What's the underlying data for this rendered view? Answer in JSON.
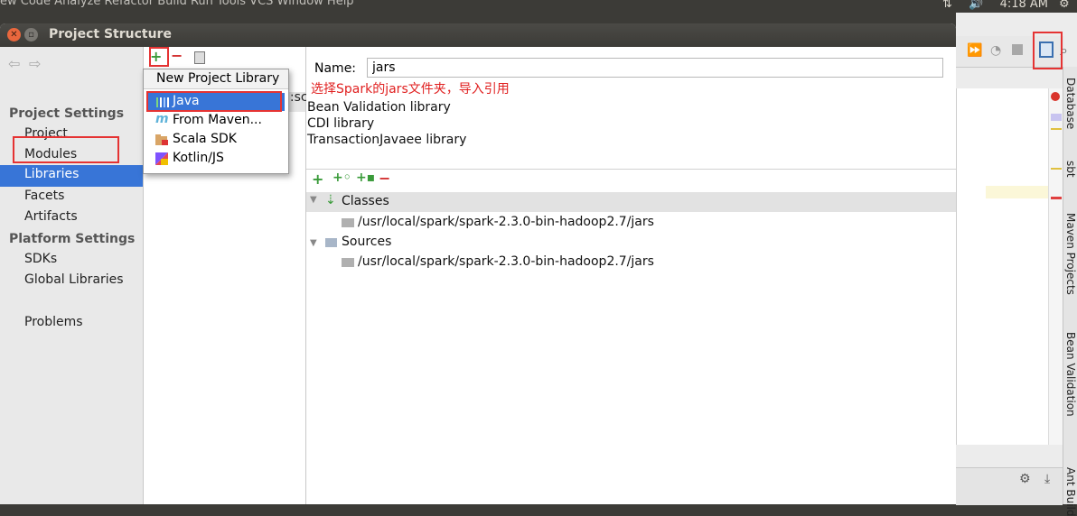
{
  "system_bar": {
    "menu_ghost": "ew   Code   Analyze   Refactor   Build   Run   Tools   VCS   Window   Help",
    "clock": "4:18 AM"
  },
  "ide": {
    "side_tabs": [
      "Database",
      "sbt",
      "Maven Projects",
      "Bean Validation",
      "Ant Build"
    ]
  },
  "dialog": {
    "title": "Project Structure",
    "sidebar": {
      "project_settings_header": "Project Settings",
      "project_items": [
        "Project",
        "Modules",
        "Libraries",
        "Facets",
        "Artifacts"
      ],
      "platform_settings_header": "Platform Settings",
      "platform_items": [
        "SDKs",
        "Global Libraries"
      ],
      "other_items": [
        "Problems"
      ],
      "selected": "Libraries"
    },
    "middle": {
      "partial_text": "g:sc"
    },
    "detail": {
      "name_label": "Name:",
      "name_value": "jars",
      "annotation": "选择Spark的jars文件夹，导入引用",
      "library_list": [
        "Bean Validation library",
        "CDI library",
        "TransactionJavaee library"
      ],
      "tree": {
        "classes_label": "Classes",
        "classes_path": "/usr/local/spark/spark-2.3.0-bin-hadoop2.7/jars",
        "sources_label": "Sources",
        "sources_path": "/usr/local/spark/spark-2.3.0-bin-hadoop2.7/jars"
      }
    },
    "popup": {
      "title": "New Project Library",
      "items": [
        "Java",
        "From Maven...",
        "Scala SDK",
        "Kotlin/JS"
      ],
      "selected": "Java"
    }
  },
  "colors": {
    "selection": "#3875d7",
    "annotation_red": "#e02020",
    "add_green": "#3a9b3a",
    "remove_red": "#d32f2f"
  }
}
